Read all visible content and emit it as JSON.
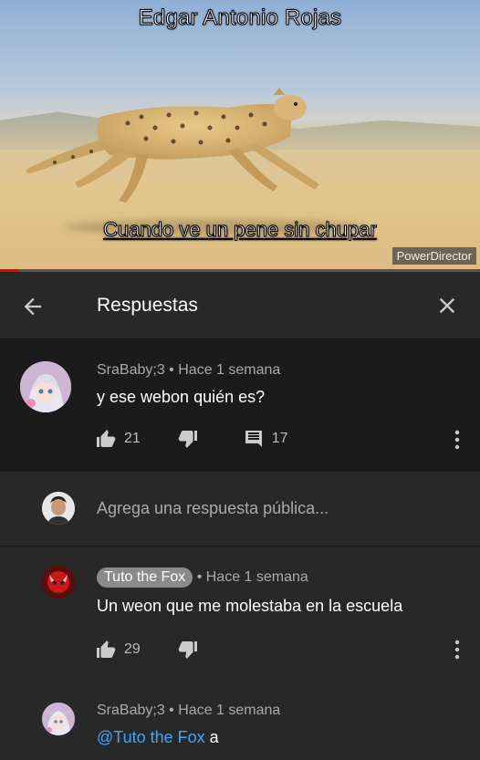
{
  "video": {
    "overlay_title": "Edgar Antonio Rojas",
    "caption": "Cuando ve un pene sin chupar",
    "watermark": "PowerDirector",
    "progress": 0.04
  },
  "header": {
    "title": "Respuestas",
    "back_icon": "arrow-left-icon",
    "close_icon": "close-icon"
  },
  "root_comment": {
    "author": "SraBaby;3",
    "separator": "•",
    "time": "Hace 1 semana",
    "text": "y ese webon quién es?",
    "likes": "21",
    "replies": "17"
  },
  "reply_input": {
    "placeholder": "Agrega una respuesta pública..."
  },
  "replies": [
    {
      "author": "Tuto the Fox",
      "separator": "•",
      "time": "Hace 1 semana",
      "text": "Un weon que me molestaba en la escuela",
      "likes": "29"
    },
    {
      "author": "SraBaby;3",
      "separator": "•",
      "time": "Hace 1 semana",
      "mention": "@Tuto the Fox",
      "text": "a"
    }
  ],
  "colors": {
    "background": "#212121",
    "root_bg": "#1b1b1b",
    "mention": "#3ea6ff",
    "progress": "#ee0000"
  }
}
